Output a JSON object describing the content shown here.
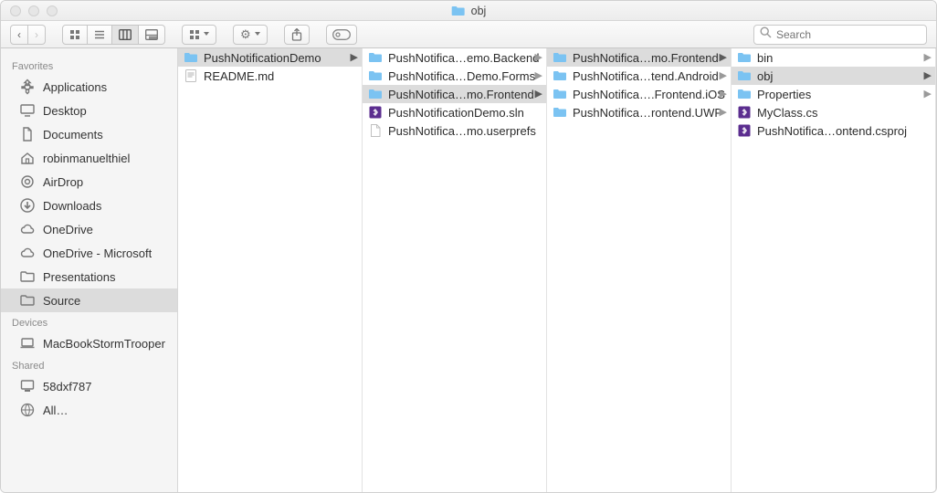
{
  "window": {
    "title": "obj"
  },
  "search": {
    "placeholder": "Search"
  },
  "sidebar": {
    "sections": [
      {
        "header": "Favorites",
        "items": [
          {
            "icon": "apps",
            "label": "Applications"
          },
          {
            "icon": "desktop",
            "label": "Desktop"
          },
          {
            "icon": "doc",
            "label": "Documents"
          },
          {
            "icon": "home",
            "label": "robinmanuelthiel"
          },
          {
            "icon": "airdrop",
            "label": "AirDrop"
          },
          {
            "icon": "downloads",
            "label": "Downloads"
          },
          {
            "icon": "cloud",
            "label": "OneDrive"
          },
          {
            "icon": "cloud",
            "label": "OneDrive - Microsoft"
          },
          {
            "icon": "folder",
            "label": "Presentations"
          },
          {
            "icon": "folder",
            "label": "Source",
            "selected": true
          }
        ]
      },
      {
        "header": "Devices",
        "items": [
          {
            "icon": "laptop",
            "label": "MacBookStormTrooper"
          }
        ]
      },
      {
        "header": "Shared",
        "items": [
          {
            "icon": "pc",
            "label": "58dxf787"
          },
          {
            "icon": "globe",
            "label": "All…"
          }
        ]
      }
    ]
  },
  "columns": [
    {
      "items": [
        {
          "type": "folder",
          "label": "PushNotificationDemo",
          "hasChildren": true,
          "selected": true
        },
        {
          "type": "md",
          "label": "README.md"
        }
      ]
    },
    {
      "items": [
        {
          "type": "folder",
          "label": "PushNotifica…emo.Backend",
          "hasChildren": true
        },
        {
          "type": "folder",
          "label": "PushNotifica…Demo.Forms",
          "hasChildren": true
        },
        {
          "type": "folder",
          "label": "PushNotifica…mo.Frontend",
          "hasChildren": true,
          "selected": true
        },
        {
          "type": "vs",
          "label": "PushNotificationDemo.sln"
        },
        {
          "type": "doc",
          "label": "PushNotifica…mo.userprefs"
        }
      ]
    },
    {
      "items": [
        {
          "type": "folder",
          "label": "PushNotifica…mo.Frontend",
          "hasChildren": true,
          "selected": true
        },
        {
          "type": "folder",
          "label": "PushNotifica…tend.Android",
          "hasChildren": true
        },
        {
          "type": "folder",
          "label": "PushNotifica….Frontend.iOS",
          "hasChildren": true
        },
        {
          "type": "folder",
          "label": "PushNotifica…rontend.UWP",
          "hasChildren": true
        }
      ]
    },
    {
      "items": [
        {
          "type": "folder",
          "label": "bin",
          "hasChildren": true
        },
        {
          "type": "folder",
          "label": "obj",
          "hasChildren": true,
          "selected": true
        },
        {
          "type": "folder",
          "label": "Properties",
          "hasChildren": true
        },
        {
          "type": "vs",
          "label": "MyClass.cs"
        },
        {
          "type": "vs",
          "label": "PushNotifica…ontend.csproj"
        }
      ]
    }
  ]
}
